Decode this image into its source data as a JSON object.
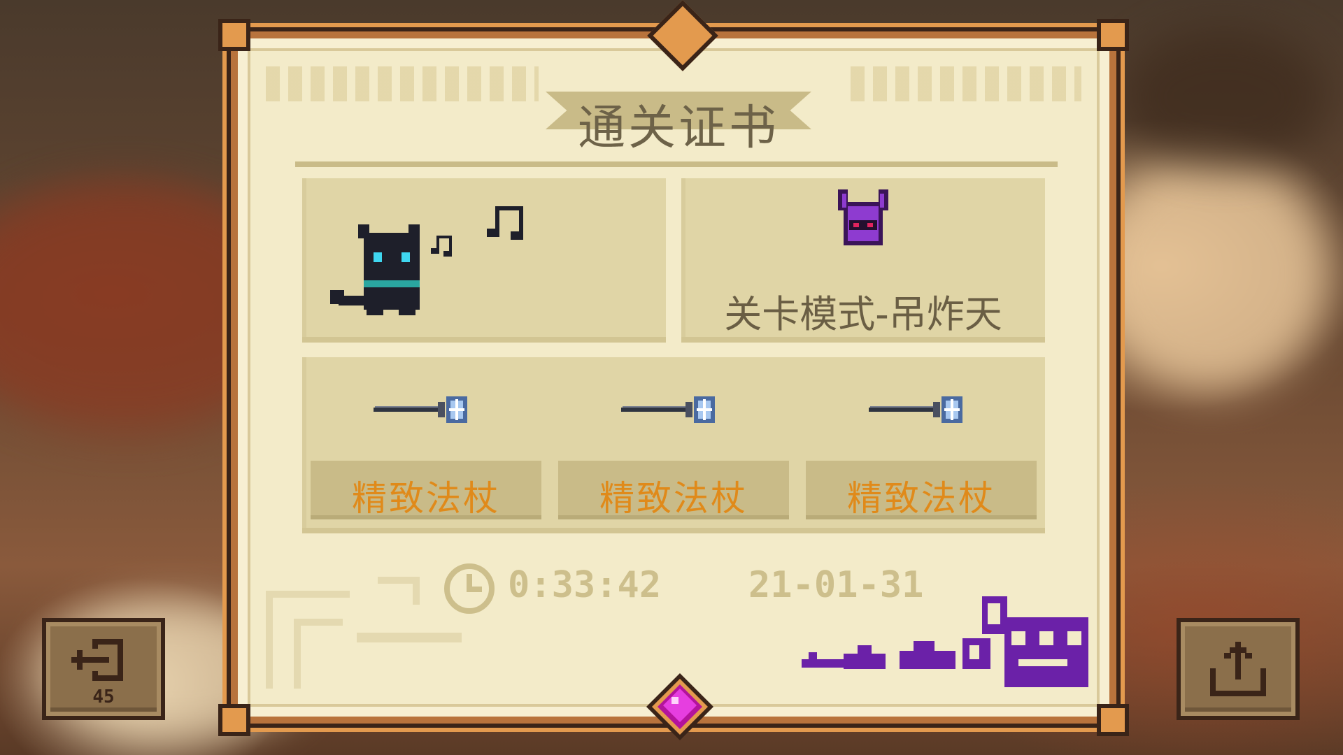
{
  "certificate": {
    "title": "通关证书",
    "mode": "关卡模式-吊炸天",
    "items": [
      {
        "name": "精致法杖",
        "icon": "staff-icon"
      },
      {
        "name": "精致法杖",
        "icon": "staff-icon"
      },
      {
        "name": "精致法杖",
        "icon": "staff-icon"
      }
    ],
    "time": "0:33:42",
    "date": "21-01-31",
    "character_icon": "black-cat-icon",
    "boss_icon": "horned-helmet-icon"
  },
  "buttons": {
    "exit_count": "45",
    "exit_icon": "exit-icon",
    "share_icon": "share-icon"
  },
  "colors": {
    "parchment": "#f3ebc9",
    "panel": "#e0d5a6",
    "item_text": "#e08a1a",
    "frame": "#b8733c",
    "gem": "#d946ef",
    "signature": "#6b21a8"
  }
}
